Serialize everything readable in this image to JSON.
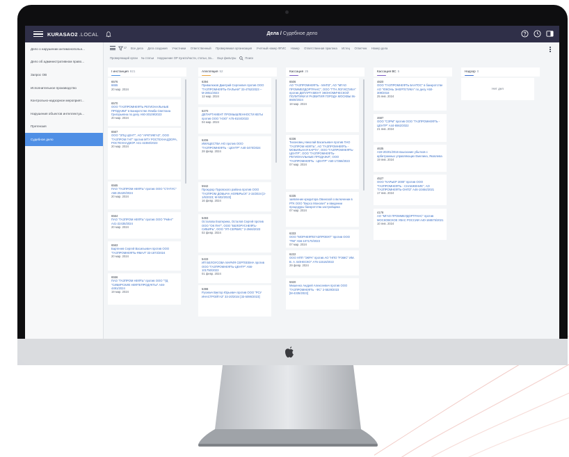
{
  "app": {
    "brand": "KURASAO2",
    "brand_suffix": ".LOCAL",
    "breadcrumb_parent": "Дела",
    "breadcrumb_sep": "/",
    "breadcrumb_current": "Судебное дело"
  },
  "sidebar": {
    "items": [
      {
        "label": "Дело о нарушении антимонопольн..."
      },
      {
        "label": "Дело об административном право..."
      },
      {
        "label": "Запрос ОВ"
      },
      {
        "label": "Исполнительное производство"
      },
      {
        "label": "Контрольно-надзорное мероприят..."
      },
      {
        "label": "Нарушения объектов интеллектуа..."
      },
      {
        "label": "Претензия"
      },
      {
        "label": "Судебное дело"
      }
    ]
  },
  "toolbar": {
    "filter_count": "17",
    "columns": [
      "Все дела",
      "Дата создания",
      "Участники",
      "Ответственный",
      "Проверяемая организация",
      "Учетный номер ФГИС",
      "Номер",
      "Ответственная практика",
      "Истец",
      "Ответчик",
      "Номер дела"
    ],
    "row2": [
      "Проверяющий орган",
      "№ статьи",
      "Нарушение ОР пункта/части, статьи, За...",
      "Еще фильтры"
    ],
    "search_label": "Поиск"
  },
  "board": {
    "columns": [
      {
        "title": "I инстанция",
        "count": "921",
        "color": "#4a90e2",
        "cards": [
          {
            "num": "6576",
            "text": "6655",
            "date": "20 мар. 2024"
          },
          {
            "num": "6570",
            "text": "ООО \"ГАЗПРОМНЕФТЬ РЕГИОНАЛЬНЫЕ ПРОДАЖИ\" в Банкротстве Лемба Светлана Григорьевна по делу А60-30109/2023",
            "date": "20 мар. 2024"
          },
          {
            "num": "6567",
            "text": "ООО \"ЗПЦ ЦЕНТ\", АО \"АРКТИКГАЗ\", ООО \"ГАЗПРОМ ГНГ\" против МТУ РОСТЕХНАДЗОРА, РОСТЕХНАДЗОР А41-42350/2023",
            "date": "20 мар. 2024"
          },
          {
            "num": "6565",
            "text": "ПАО \"ГАЗПРОМ НЕФТЬ\" против ООО \"СТАТУС\" А56-25420/2024",
            "date": "20 мар. 2024"
          },
          {
            "num": "6564",
            "text": "ПАО \"ГАЗПРОМ НЕФТЬ\" против ООО \"Рейнт\" А41-22435/2024",
            "date": "20 мар. 2024"
          },
          {
            "num": "6563",
            "text": "Бартенев Сергей Васильевич против ООО \"ГАЗПРОМНЕФТЬ-ЯМАЛ\" 33-1873/2024",
            "date": "20 мар. 2024"
          },
          {
            "num": "6556",
            "text": "ПАО \"ГАЗПРОМ НЕФТЬ\" против ООО \"ТД \"СИБИРСКИЕ НЕФТЕПРОДУКТЫ\" А46-4491/2024",
            "date": "19 мар. 2024"
          }
        ]
      },
      {
        "title": "Апелляция",
        "count": "52",
        "color": "#e8a23a",
        "cards": [
          {
            "num": "6394",
            "text": "Привалюков Дмитрий Сергеевич против ООО \"ГАЗПРОМНЕФТЬ-ПАЛЬНИ\" 33-4752/2023 -- М-2851/2023",
            "date": "12 мар. 2024"
          },
          {
            "num": "6270",
            "text": "ДЕПАРТАМЕНТ ПРОМЫШЛЕННОСТИ КЕГЫ против ООО \"НЭО\" А75-8104/2023",
            "date": "04 мар. 2024"
          },
          {
            "num": "6206",
            "text": "ИМУЩЕСТВА НО против ООО \"ГАЗПРОМНЕФТЬ - ЦЕНТР\" А40-3470/2024",
            "date": "28 февр. 2024"
          },
          {
            "num": "5942",
            "text": "Прокурор Пуровского района против ООО \"ГАЗПРОМ ДОБЫЧА НОЯБРЬСК\" 2-15/2024 [2-1/6/2023; М-502/2023]",
            "date": "16 февр. 2024"
          },
          {
            "num": "5493",
            "text": "Осталова Екатерина, Осталов Сергей против ООО \"ОК ПНГ\", ООО \"БЕЛОРУСНЕФТЬ-СИБИРЬ\", ООО \"УП-СЕРВИС\" 2-2946/2023",
            "date": "02 февр. 2024"
          },
          {
            "num": "5433",
            "text": "ИП БЕЛОУСОВА МАРИЯ СЕРГЕЕВНА против ООО \"ГАЗПРОМНЕФТЬ-ЦЕНТР\" А56-101750/2023",
            "date": "01 февр. 2024"
          },
          {
            "num": "5398",
            "text": "Русевич Виктор Юрьевич против ООО \"РСУ ИНАСТРОЙГАЗ\" 33-20/2024 [33-5095/2023]",
            "date": ""
          }
        ]
      },
      {
        "title": "Кассация",
        "count": "25",
        "color": "#7c5cc4",
        "cards": [
          {
            "num": "6506",
            "text": "АО \"ГАЗПРОМНЕФТЬ - МНПЗ\", АО \"МГАО ПРОММЕЛДОРТРАНС\", ООО \"ГТН ЛОГИСТИКА\" против ДЕПАРТАМЕНТ ЭКОНОМИЧЕСКОЙ ПОЛИТИКИ И РАЗВИТИЯ ГОРОДА МОСКВЫ 8s-8600/2024",
            "date": "18 мар. 2024"
          },
          {
            "num": "6336",
            "text": "Тихоновец Николай Васильевич против ПАО \"ГАЗПРОМ НЕФТЬ\", АО \"ГАЗПРОМНЕФТЬ - МОБИЛЬНАЯ КАРТА\", ООО \"ГАЗПРОМНЕФТЬ-ЦЕНТР\", ООО \"ГАЗПРОМНЕФТЬ-РЕГИОНАЛЬНЫЕ ПРОДАЖИ\", ООО \"ГАЗПРОМНЕФТЬ - ЦЕНТР\" А50-17366/2023",
            "date": "07 мар. 2024"
          },
          {
            "num": "6335",
            "text": "заявление кредитора Овинской о включении в РТК ООО \"Версо Монолит\" и введении процедуры банкротства застройщика",
            "date": "07 мар. 2024"
          },
          {
            "num": "6333",
            "text": "ООО \"МОРНЕФТЕГАЗПРОЕКТ\" против ООО \"ПМ\" А56-107170/2023",
            "date": "07 мар. 2024"
          },
          {
            "num": "6222",
            "text": "ООО НПП \"ЭКРА\" против АО \"НПО \"РЭМС\" ИМ. В. А. БОНЕСКО\" А75-11516/2022",
            "date": "29 февр. 2024"
          },
          {
            "num": "5920",
            "text": "Мишенко Андрей Алексеевич против ООО \"ГАЗПРОМНЕФТЬ - ФС\" 2-5529/2023 [М-4335/2023]",
            "date": ""
          }
        ]
      },
      {
        "title": "Кассация ВС",
        "count": "5",
        "color": "#7c5cc4",
        "cards": [
          {
            "num": "4820",
            "text": "ООО \"ГАЗПРОМНЕФТЬ БАНТОС\" в банкротстве АО \"ЮКОНЬ ЭНЕРГЕТИКА\" по делу А50-309/2018",
            "date": "25 янв. 2024"
          },
          {
            "num": "4687",
            "text": "ООО \"СЗРМ\" против ООО \"ГАЗПРОМНЕФТЬ - ЦЕНТР\" А44-6562/2022",
            "date": "21 янв. 2024"
          },
          {
            "num": "4635",
            "text": "А33-20201/2016 взыскание убытков с арбитражных управляющих Емелина, Яковлева",
            "date": "19 янв. 2024"
          },
          {
            "num": "4527",
            "text": "ООО \"КАРЬЕР 2000\" против ООО \"ГАЗПРОМНЕФТЬ - СНАБЖЕНИЕ\", АО \"ГАЗПРОМНЕФТЬ-ОНПЗ\" А46-10464/2021",
            "date": "17 янв. 2024"
          },
          {
            "num": "4178",
            "text": "АО \"МГАО ПРОММЕЛДОРТРАНС\" против МОСКОВСКОЕ УВАС РОССИИ А40-166575/2021",
            "date": "10 янв. 2024"
          }
        ]
      },
      {
        "title": "Надзор",
        "count": "0",
        "color": "#3b6fd1",
        "empty_label": "Нет дел",
        "cards": []
      }
    ]
  }
}
